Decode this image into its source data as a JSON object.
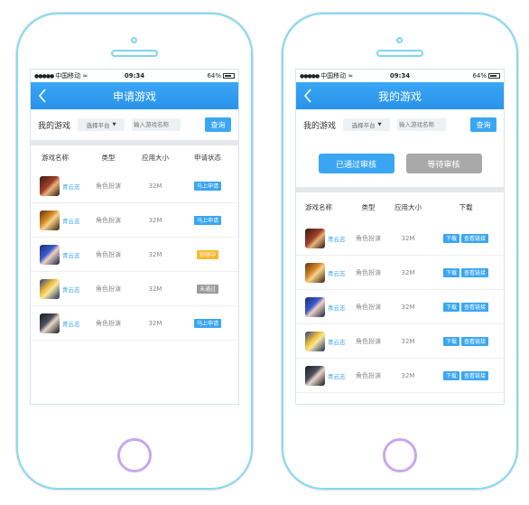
{
  "colors": {
    "accent": "#3aa6f2",
    "pending_yellow": "#f7b92e",
    "reject_gray": "#9a9a9a",
    "tab_inactive": "#a9a9a9"
  },
  "status_bar": {
    "carrier": "中国移动",
    "time": "09:34",
    "battery": "64%"
  },
  "left": {
    "title": "申请游戏",
    "filter": {
      "label": "我的游戏",
      "platform": "选择平台",
      "search_placeholder": "输入游戏名称",
      "query_button": "查询"
    },
    "columns": [
      "游戏名称",
      "类型",
      "应用大小",
      "申请状态"
    ],
    "rows": [
      {
        "icon": "game-avatar-1",
        "name": "青云志",
        "type": "角色扮演",
        "size": "32M",
        "status": "马上申请",
        "status_color": "#3aa6f2"
      },
      {
        "icon": "game-avatar-2",
        "name": "青云志",
        "type": "角色扮演",
        "size": "32M",
        "status": "马上申请",
        "status_color": "#3aa6f2"
      },
      {
        "icon": "game-avatar-3",
        "name": "青云志",
        "type": "角色扮演",
        "size": "32M",
        "status": "审核中",
        "status_color": "#f7b92e"
      },
      {
        "icon": "game-avatar-4",
        "name": "青云志",
        "type": "角色扮演",
        "size": "32M",
        "status": "未通过",
        "status_color": "#9a9a9a"
      },
      {
        "icon": "game-avatar-5",
        "name": "青云志",
        "type": "角色扮演",
        "size": "32M",
        "status": "马上申请",
        "status_color": "#3aa6f2"
      }
    ]
  },
  "right": {
    "title": "我的游戏",
    "filter": {
      "label": "我的游戏",
      "platform": "选择平台",
      "search_placeholder": "输入游戏名称",
      "query_button": "查询"
    },
    "tabs": [
      {
        "label": "已通过审核",
        "active": true
      },
      {
        "label": "等待审核",
        "active": false
      }
    ],
    "columns": [
      "游戏名称",
      "类型",
      "应用大小",
      "下载"
    ],
    "rows": [
      {
        "icon": "game-avatar-1",
        "name": "青云志",
        "type": "角色扮演",
        "size": "32M",
        "download": "下载",
        "link": "查看链接"
      },
      {
        "icon": "game-avatar-2",
        "name": "青云志",
        "type": "角色扮演",
        "size": "32M",
        "download": "下载",
        "link": "查看链接"
      },
      {
        "icon": "game-avatar-3",
        "name": "青云志",
        "type": "角色扮演",
        "size": "32M",
        "download": "下载",
        "link": "查看链接"
      },
      {
        "icon": "game-avatar-4",
        "name": "青云志",
        "type": "角色扮演",
        "size": "32M",
        "download": "下载",
        "link": "查看链接"
      },
      {
        "icon": "game-avatar-5",
        "name": "青云志",
        "type": "角色扮演",
        "size": "32M",
        "download": "下载",
        "link": "查看链接"
      }
    ]
  }
}
